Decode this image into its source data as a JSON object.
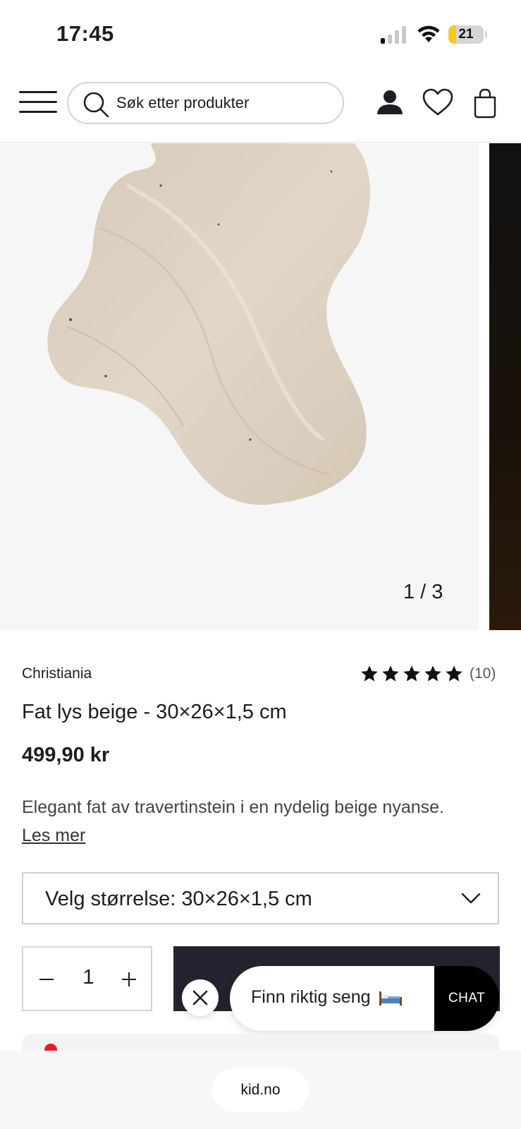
{
  "status_bar": {
    "time": "17:45",
    "battery_level": "21",
    "battery_color": "#f2cb1e",
    "signal_bars_active": 1
  },
  "header": {
    "menu_icon": "hamburger-icon",
    "search_placeholder": "Søk etter produkter",
    "icons": [
      "search-icon",
      "account-icon",
      "heart-icon",
      "bag-icon"
    ]
  },
  "gallery": {
    "counter": "1 / 3"
  },
  "product": {
    "brand": "Christiania",
    "rating_stars": 5,
    "rating_count": "(10)",
    "title": "Fat lys beige - 30×26×1,5 cm",
    "price": "499,90 kr",
    "description": "Elegant fat av travertinstein i en nydelig beige nyanse.",
    "read_more": "Les mer",
    "size_select": "Velg størrelse: 30×26×1,5 cm",
    "quantity": "1"
  },
  "chat": {
    "prompt": "Finn riktig seng",
    "button": "CHAT"
  },
  "browser": {
    "url": "kid.no"
  },
  "colors": {
    "primary_dark": "#27222f",
    "text": "#1c1c22",
    "star": "#111111"
  }
}
